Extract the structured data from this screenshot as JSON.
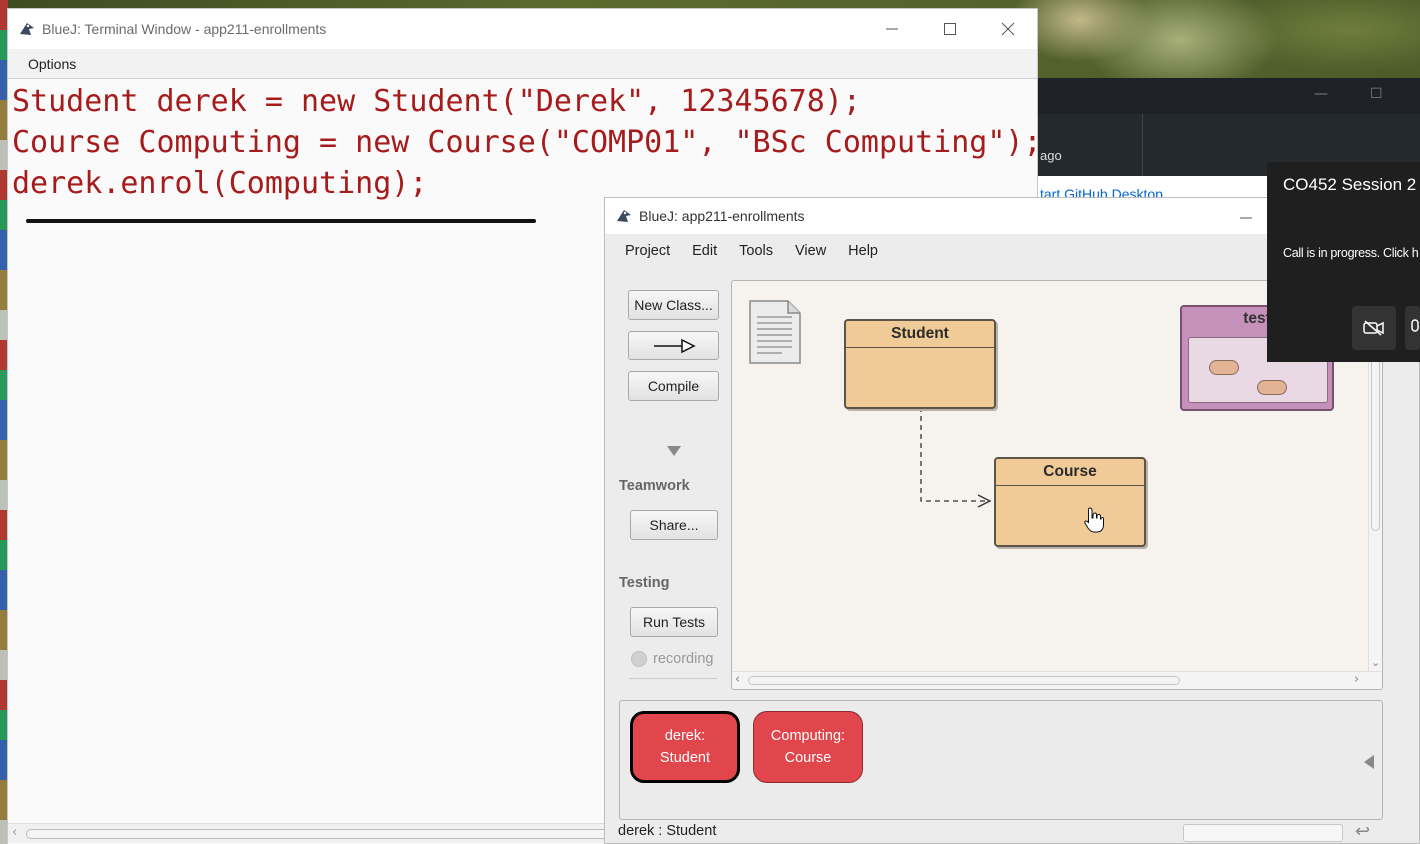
{
  "terminal": {
    "title": "BlueJ: Terminal Window - app211-enrollments",
    "menu": [
      "Options"
    ],
    "lines": [
      "Student derek = new Student(\"Derek\", 12345678);",
      "Course Computing = new Course(\"COMP01\", \"BSc Computing\");",
      "derek.enrol(Computing);"
    ]
  },
  "github": {
    "ago_text": "ago",
    "link_text": "tart GitHub Desktop"
  },
  "call": {
    "title": "CO452 Session 2",
    "status": "Call is in progress. Click h"
  },
  "bluej": {
    "title": "BlueJ:  app211-enrollments",
    "menu": [
      "Project",
      "Edit",
      "Tools",
      "View",
      "Help"
    ],
    "buttons": {
      "new_class": "New Class...",
      "compile": "Compile",
      "share": "Share...",
      "run_tests": "Run Tests"
    },
    "labels": {
      "teamwork": "Teamwork",
      "testing": "Testing",
      "recording": "recording"
    },
    "classes": {
      "student": "Student",
      "course": "Course",
      "test": "test"
    },
    "objects": [
      {
        "line1": "derek:",
        "line2": "Student"
      },
      {
        "line1": "Computing:",
        "line2": "Course"
      }
    ],
    "status_text": "derek : Student"
  },
  "colors": {
    "code_text": "#a61b1b",
    "class_fill": "#f0cb97",
    "test_fill": "#c591bb",
    "object_fill": "#e0464b"
  }
}
